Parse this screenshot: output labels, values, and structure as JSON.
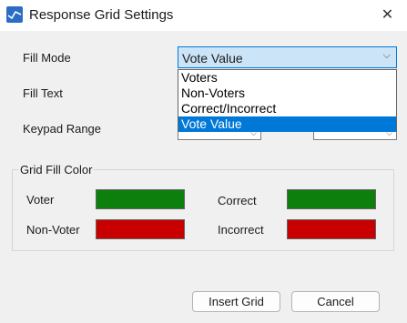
{
  "window": {
    "title": "Response Grid Settings",
    "close_glyph": "✕",
    "icon": "chart-icon"
  },
  "form": {
    "fill_mode_label": "Fill Mode",
    "fill_mode_value": "Vote Value",
    "fill_text_label": "Fill Text",
    "keypad_range_label": "Keypad Range",
    "chevron": "⌵"
  },
  "dropdown": {
    "options": [
      "Voters",
      "Non-Voters",
      "Correct/Incorrect",
      "Vote Value"
    ],
    "selected": "Vote Value"
  },
  "grid_fill_color": {
    "title": "Grid Fill Color",
    "voter_label": "Voter",
    "voter_color": "#0d7f0d",
    "non_voter_label": "Non-Voter",
    "non_voter_color": "#c80000",
    "correct_label": "Correct",
    "correct_color": "#0d7f0d",
    "incorrect_label": "Incorrect",
    "incorrect_color": "#c80000"
  },
  "buttons": {
    "insert_grid": "Insert Grid",
    "cancel": "Cancel"
  }
}
